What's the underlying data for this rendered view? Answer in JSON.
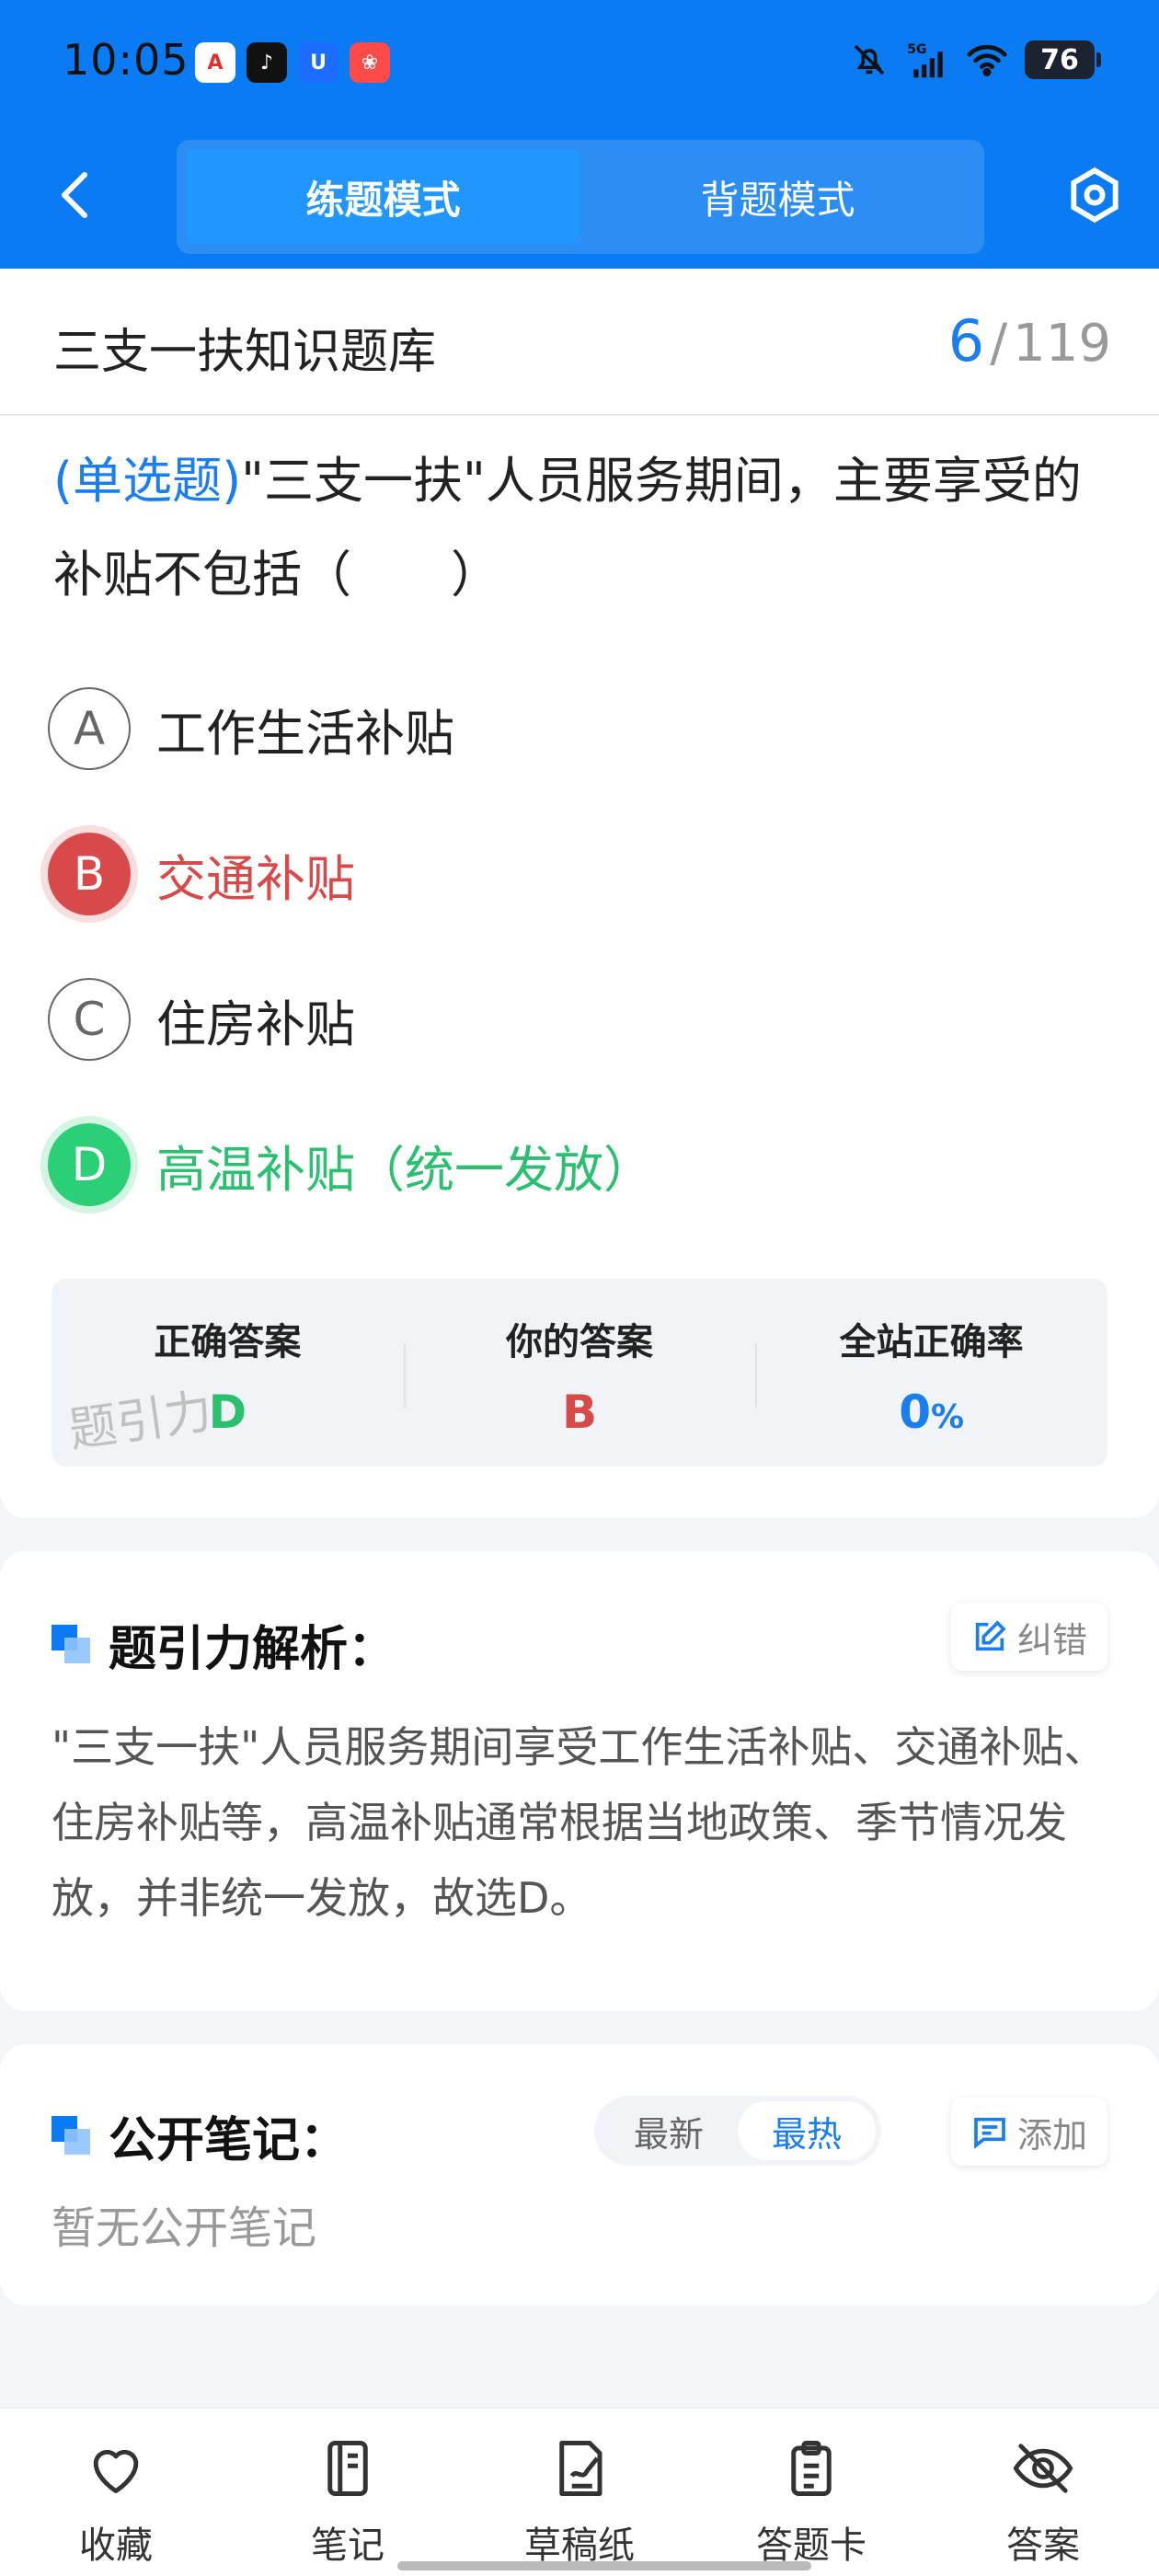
{
  "status_bar": {
    "time": "10:05",
    "battery": "76",
    "network": "5G",
    "notification_icons": [
      "app-a-icon",
      "tiktok-icon",
      "app-u-icon",
      "app-red-icon"
    ],
    "notification_glyphs": [
      "A",
      "♪",
      "U",
      "❀"
    ]
  },
  "header": {
    "tabs": [
      {
        "label": "练题模式",
        "active": true
      },
      {
        "label": "背题模式",
        "active": false
      }
    ],
    "accent": "#0a7bf2"
  },
  "question": {
    "bank_name": "三支一扶知识题库",
    "current": "6",
    "separator": "/",
    "total": "119",
    "type_label": "(单选题)",
    "text": "\"三支一扶\"人员服务期间，主要享受的补贴不包括（　　）",
    "options": [
      {
        "letter": "A",
        "text": "工作生活补贴",
        "state": "normal"
      },
      {
        "letter": "B",
        "text": "交通补贴",
        "state": "wrong"
      },
      {
        "letter": "C",
        "text": "住房补贴",
        "state": "normal"
      },
      {
        "letter": "D",
        "text": "高温补贴（统一发放）",
        "state": "correct"
      }
    ]
  },
  "answer_summary": {
    "correct_title": "正确答案",
    "correct_value": "D",
    "mine_title": "你的答案",
    "mine_value": "B",
    "rate_title": "全站正确率",
    "rate_value": "0",
    "rate_unit": "%",
    "watermark": "题引力"
  },
  "analysis": {
    "title": "题引力解析：",
    "correct_button": "纠错",
    "text": "\"三支一扶\"人员服务期间享受工作生活补贴、交通补贴、住房补贴等，高温补贴通常根据当地政策、季节情况发放，并非统一发放，故选D。"
  },
  "notes": {
    "title": "公开笔记：",
    "sort_options": [
      {
        "label": "最新",
        "active": false
      },
      {
        "label": "最热",
        "active": true
      }
    ],
    "add_button": "添加",
    "empty_text": "暂无公开笔记"
  },
  "bottom_bar": {
    "items": [
      {
        "label": "收藏",
        "icon": "heart-icon"
      },
      {
        "label": "笔记",
        "icon": "notebook-icon"
      },
      {
        "label": "草稿纸",
        "icon": "draft-paper-icon"
      },
      {
        "label": "答题卡",
        "icon": "answer-card-icon"
      },
      {
        "label": "答案",
        "icon": "eye-off-icon"
      }
    ]
  }
}
